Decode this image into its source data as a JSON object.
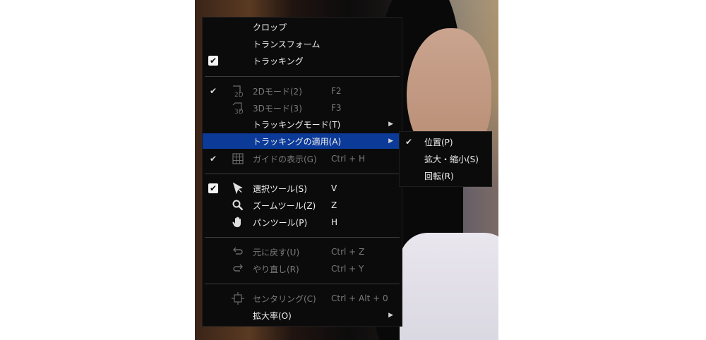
{
  "main_menu": {
    "items": [
      {
        "label": "クロップ",
        "checked": false
      },
      {
        "label": "トランスフォーム",
        "checked": false
      },
      {
        "label": "トラッキング",
        "checked": true
      }
    ],
    "view_items": [
      {
        "label": "2Dモード(2)",
        "shortcut": "F2",
        "checked": true,
        "disabled": true,
        "icon": "2d-icon"
      },
      {
        "label": "3Dモード(3)",
        "shortcut": "F3",
        "checked": false,
        "disabled": true,
        "icon": "3d-icon"
      },
      {
        "label": "トラッキングモード(T)",
        "has_submenu": true
      },
      {
        "label": "トラッキングの適用(A)",
        "has_submenu": true,
        "highlighted": true
      },
      {
        "label": "ガイドの表示(G)",
        "shortcut": "Ctrl + H",
        "checked": true,
        "disabled": true,
        "icon": "grid-icon"
      }
    ],
    "tool_items": [
      {
        "label": "選択ツール(S)",
        "shortcut": "V",
        "checked": true,
        "icon": "pointer-icon"
      },
      {
        "label": "ズームツール(Z)",
        "shortcut": "Z",
        "icon": "magnifier-icon"
      },
      {
        "label": "パンツール(P)",
        "shortcut": "H",
        "icon": "hand-icon"
      }
    ],
    "edit_items": [
      {
        "label": "元に戻す(U)",
        "shortcut": "Ctrl + Z",
        "disabled": true,
        "icon": "undo-icon"
      },
      {
        "label": "やり直し(R)",
        "shortcut": "Ctrl + Y",
        "disabled": true,
        "icon": "redo-icon"
      }
    ],
    "zoom_items": [
      {
        "label": "センタリング(C)",
        "shortcut": "Ctrl + Alt + 0",
        "disabled": true,
        "icon": "center-icon"
      },
      {
        "label": "拡大率(O)",
        "has_submenu": true
      }
    ]
  },
  "submenu": {
    "items": [
      {
        "label": "位置(P)",
        "checked": true
      },
      {
        "label": "拡大・縮小(S)",
        "checked": false
      },
      {
        "label": "回転(R)",
        "checked": false
      }
    ]
  },
  "colors": {
    "menu_bg": "#0b0b0b",
    "highlight": "#0b3a98",
    "disabled_text": "#7a7a7a"
  }
}
